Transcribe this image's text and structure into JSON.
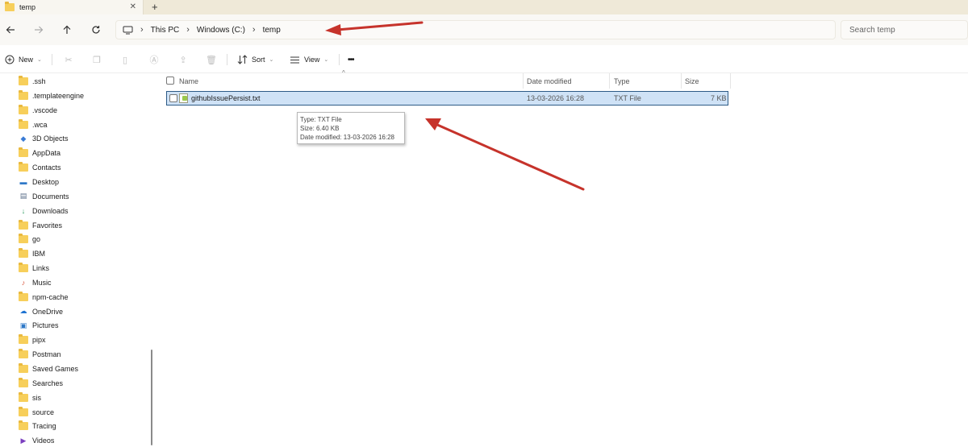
{
  "tab": {
    "title": "temp",
    "close": "✕",
    "new_tab": "+"
  },
  "nav": {
    "breadcrumb": [
      "This PC",
      "Windows (C:)",
      "temp"
    ],
    "search_placeholder": "Search temp"
  },
  "toolbar": {
    "new_label": "New",
    "sort_label": "Sort",
    "view_label": "View",
    "more_label": "•••"
  },
  "sidebar": {
    "items": [
      {
        "label": ".ssh",
        "icon": "folder"
      },
      {
        "label": ".templateengine",
        "icon": "folder"
      },
      {
        "label": ".vscode",
        "icon": "folder"
      },
      {
        "label": ".wca",
        "icon": "folder"
      },
      {
        "label": "3D Objects",
        "icon": "3d-objects"
      },
      {
        "label": "AppData",
        "icon": "folder"
      },
      {
        "label": "Contacts",
        "icon": "folder"
      },
      {
        "label": "Desktop",
        "icon": "desktop"
      },
      {
        "label": "Documents",
        "icon": "documents"
      },
      {
        "label": "Downloads",
        "icon": "downloads"
      },
      {
        "label": "Favorites",
        "icon": "folder"
      },
      {
        "label": "go",
        "icon": "folder"
      },
      {
        "label": "IBM",
        "icon": "folder"
      },
      {
        "label": "Links",
        "icon": "folder"
      },
      {
        "label": "Music",
        "icon": "music"
      },
      {
        "label": "npm-cache",
        "icon": "folder"
      },
      {
        "label": "OneDrive",
        "icon": "onedrive"
      },
      {
        "label": "Pictures",
        "icon": "pictures"
      },
      {
        "label": "pipx",
        "icon": "folder"
      },
      {
        "label": "Postman",
        "icon": "folder"
      },
      {
        "label": "Saved Games",
        "icon": "folder"
      },
      {
        "label": "Searches",
        "icon": "folder"
      },
      {
        "label": "sis",
        "icon": "folder"
      },
      {
        "label": "source",
        "icon": "folder"
      },
      {
        "label": "Tracing",
        "icon": "folder"
      },
      {
        "label": "Videos",
        "icon": "videos"
      }
    ]
  },
  "columns": {
    "name": "Name",
    "date": "Date modified",
    "type": "Type",
    "size": "Size"
  },
  "files": [
    {
      "name": "githubIssuePersist.txt",
      "date": "13-03-2026 16:28",
      "type": "TXT File",
      "size": "7 KB"
    }
  ],
  "tooltip": {
    "type": "Type: TXT File",
    "size": "Size: 6.40 KB",
    "date": "Date modified: 13-03-2026 16:28"
  },
  "colors": {
    "annotation": "#c6332b",
    "selection": "#cfe2f6",
    "folder": "#f7cf5b"
  }
}
